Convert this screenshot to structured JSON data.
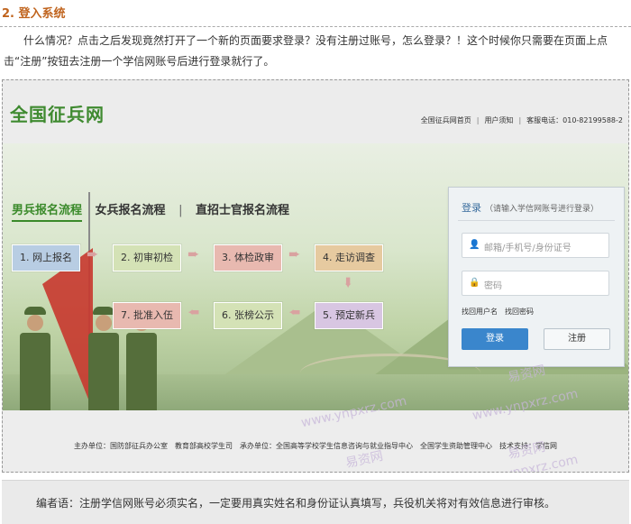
{
  "article": {
    "heading": "2. 登入系统",
    "paragraph": "什么情况？点击之后发现竟然打开了一个新的页面要求登录？没有注册过账号，怎么登录？！这个时候你只需要在页面上点击“注册”按钮去注册一个学信网账号后进行登录就行了。"
  },
  "site": {
    "logo": "全国征兵网",
    "top_links": [
      "全国征兵网首页",
      "用户须知",
      "客服电话：010-82199588-2"
    ]
  },
  "tabs": [
    "男兵报名流程",
    "女兵报名流程",
    "直招士官报名流程"
  ],
  "steps": [
    {
      "label": "1. 网上报名",
      "color": "#b8cde3"
    },
    {
      "label": "2. 初审初检",
      "color": "#d4e2b6"
    },
    {
      "label": "3. 体检政审",
      "color": "#e8b9b0"
    },
    {
      "label": "4. 走访调查",
      "color": "#e6caa0"
    },
    {
      "label": "5. 预定新兵",
      "color": "#d8c6e2"
    },
    {
      "label": "6. 张榜公示",
      "color": "#d4e2b6"
    },
    {
      "label": "7. 批准入伍",
      "color": "#e8b9b0"
    }
  ],
  "login": {
    "title": "登录",
    "hint": "（请输入学信网账号进行登录）",
    "username_placeholder": "邮箱/手机号/身份证号",
    "password_placeholder": "密码",
    "forgot_username": "找回用户名",
    "forgot_password": "找回密码",
    "login_button": "登录",
    "register_button": "注册"
  },
  "footer": {
    "host": "主办单位：国防部征兵办公室　教育部高校学生司",
    "organizer": "承办单位：全国高等学校学生信息咨询与就业指导中心　全国学生资助管理中心",
    "tech": "技术支持：学信网"
  },
  "note": "编者语：注册学信网账号必须实名，一定要用真实姓名和身份证认真填写，兵役机关将对有效信息进行审核。",
  "watermarks": {
    "cn": "易资网",
    "url": "www.ynpxrz.com"
  }
}
